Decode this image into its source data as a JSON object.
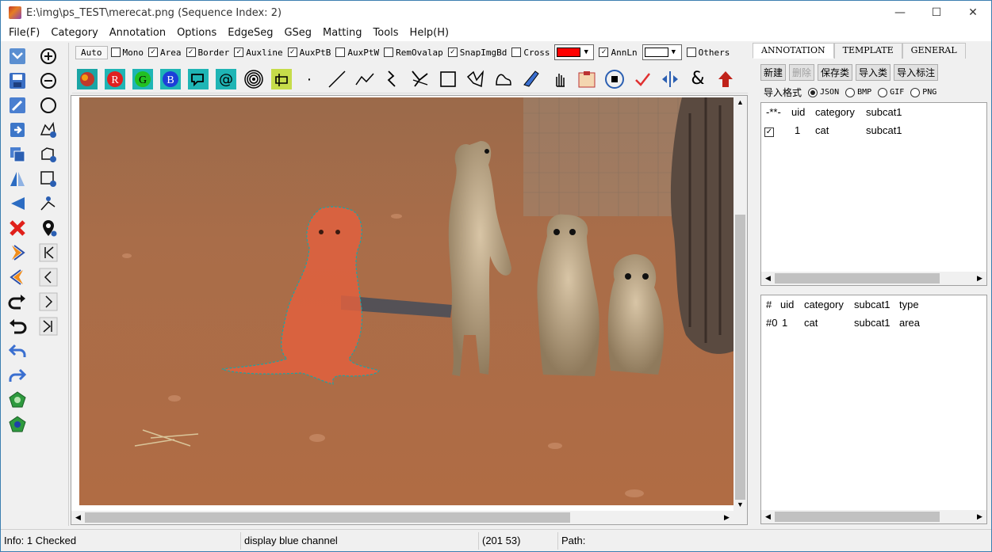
{
  "window": {
    "title": "E:\\img\\ps_TEST\\merecat.png (Sequence Index: 2)",
    "minimize": "—",
    "maximize": "☐",
    "close": "✕"
  },
  "menu": [
    "File(F)",
    "Category",
    "Annotation",
    "Options",
    "EdgeSeg",
    "GSeg",
    "Matting",
    "Tools",
    "Help(H)"
  ],
  "options": {
    "auto": "Auto",
    "checks": [
      {
        "label": "Mono",
        "checked": false
      },
      {
        "label": "Area",
        "checked": true
      },
      {
        "label": "Border",
        "checked": true
      },
      {
        "label": "Auxline",
        "checked": true
      },
      {
        "label": "AuxPtB",
        "checked": true
      },
      {
        "label": "AuxPtW",
        "checked": false
      },
      {
        "label": "RemOvalap",
        "checked": false
      },
      {
        "label": "SnapImgBd",
        "checked": true
      },
      {
        "label": "Cross",
        "checked": false
      }
    ],
    "color1": "#ff0000",
    "annln_label": "AnnLn",
    "annln_checked": true,
    "color2": "#ffffff",
    "others_label": "Others"
  },
  "toolbar_letters": {
    "r": "R",
    "g": "G",
    "b": "B",
    "at": "@",
    "amp": "&",
    "dot": "·"
  },
  "right": {
    "tabs": [
      "ANNOTATION",
      "TEMPLATE",
      "GENERAL"
    ],
    "buttons": [
      {
        "label": "新建",
        "enabled": true
      },
      {
        "label": "删除",
        "enabled": false
      },
      {
        "label": "保存类",
        "enabled": true
      },
      {
        "label": "导入类",
        "enabled": true
      },
      {
        "label": "导入标注",
        "enabled": true
      }
    ],
    "format_label": "导入格式",
    "formats": [
      {
        "label": "JSON",
        "selected": true
      },
      {
        "label": "BMP",
        "selected": false
      },
      {
        "label": "GIF",
        "selected": false
      },
      {
        "label": "PNG",
        "selected": false
      }
    ],
    "category_table": {
      "headers": [
        "-**-",
        "uid",
        "category",
        "subcat1"
      ],
      "rows": [
        {
          "checked": true,
          "uid": "1",
          "category": "cat",
          "subcat1": "subcat1"
        }
      ]
    },
    "instance_table": {
      "headers": [
        "#",
        "uid",
        "category",
        "subcat1",
        "type"
      ],
      "rows": [
        {
          "idx": "#0",
          "uid": "1",
          "category": "cat",
          "subcat1": "subcat1",
          "type": "area"
        }
      ]
    }
  },
  "status": {
    "info": "Info: 1 Checked",
    "message": "display blue channel",
    "coords": "(201  53)",
    "path": "Path:"
  },
  "colors": {
    "accent_blue": "#0078d7",
    "annotation_fill": "#e0603e",
    "ground": "#a86a47"
  }
}
